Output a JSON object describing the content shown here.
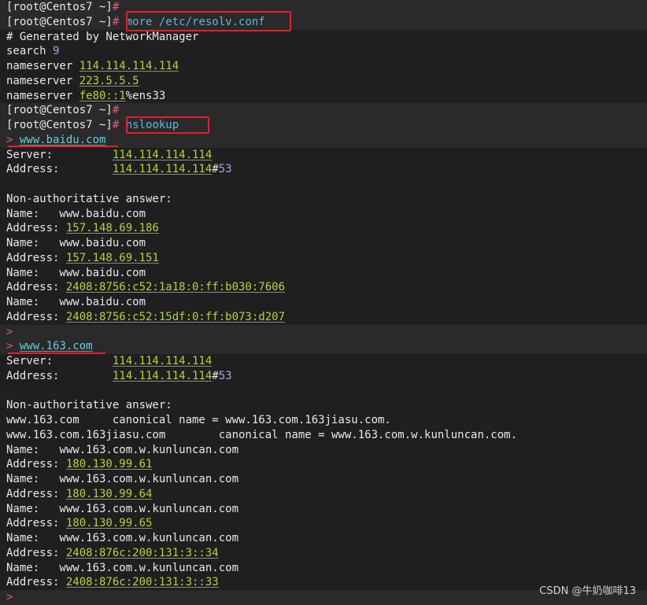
{
  "watermark": "CSDN @牛奶咖啡13",
  "colors": {
    "background": "#1f1f1f",
    "ip": "#b5d334",
    "port": "#b69ae6",
    "command": "#5fb3e6",
    "prompt_marker": "#e25a7a",
    "annotation": "#e0202a"
  },
  "lines": [
    {
      "hl": true,
      "segs": [
        {
          "t": "[root@Centos7 ~]",
          "c": "plain"
        },
        {
          "t": "#",
          "c": "hash"
        }
      ]
    },
    {
      "hl": true,
      "segs": [
        {
          "t": "[root@Centos7 ~]",
          "c": "plain"
        },
        {
          "t": "#",
          "c": "hash"
        },
        {
          "t": " more /etc/resolv.conf",
          "c": "cmd"
        }
      ]
    },
    {
      "hl": false,
      "segs": [
        {
          "t": "# Generated by NetworkManager",
          "c": "plain"
        }
      ]
    },
    {
      "hl": false,
      "segs": [
        {
          "t": "search ",
          "c": "plain"
        },
        {
          "t": "9",
          "c": "num"
        }
      ]
    },
    {
      "hl": false,
      "segs": [
        {
          "t": "nameserver ",
          "c": "plain"
        },
        {
          "t": "114.114.114.114",
          "c": "ip"
        }
      ]
    },
    {
      "hl": false,
      "segs": [
        {
          "t": "nameserver ",
          "c": "plain"
        },
        {
          "t": "223.5.5.5",
          "c": "ip"
        }
      ]
    },
    {
      "hl": false,
      "segs": [
        {
          "t": "nameserver ",
          "c": "plain"
        },
        {
          "t": "fe80::1",
          "c": "ip"
        },
        {
          "t": "%ens33",
          "c": "plain"
        }
      ]
    },
    {
      "hl": true,
      "segs": [
        {
          "t": "[root@Centos7 ~]",
          "c": "plain"
        },
        {
          "t": "#",
          "c": "hash"
        }
      ]
    },
    {
      "hl": true,
      "segs": [
        {
          "t": "[root@Centos7 ~]",
          "c": "plain"
        },
        {
          "t": "#",
          "c": "hash"
        },
        {
          "t": " nslookup",
          "c": "cmd"
        }
      ]
    },
    {
      "hl": true,
      "segs": [
        {
          "t": ">",
          "c": "prompt"
        },
        {
          "t": " ",
          "c": "plain"
        },
        {
          "t": "www.baidu.com",
          "c": "host"
        }
      ]
    },
    {
      "hl": false,
      "segs": [
        {
          "t": "Server:         ",
          "c": "plain"
        },
        {
          "t": "114.114.114.114",
          "c": "ip"
        }
      ]
    },
    {
      "hl": false,
      "segs": [
        {
          "t": "Address:        ",
          "c": "plain"
        },
        {
          "t": "114.114.114.114",
          "c": "ip"
        },
        {
          "t": "#",
          "c": "plain"
        },
        {
          "t": "53",
          "c": "num"
        }
      ]
    },
    {
      "hl": false,
      "segs": [
        {
          "t": "",
          "c": "plain"
        }
      ]
    },
    {
      "hl": false,
      "segs": [
        {
          "t": "Non-authoritative answer:",
          "c": "plain"
        }
      ]
    },
    {
      "hl": false,
      "segs": [
        {
          "t": "Name:   www.baidu.com",
          "c": "plain"
        }
      ]
    },
    {
      "hl": false,
      "segs": [
        {
          "t": "Address: ",
          "c": "plain"
        },
        {
          "t": "157.148.69.186",
          "c": "ip"
        }
      ]
    },
    {
      "hl": false,
      "segs": [
        {
          "t": "Name:   www.baidu.com",
          "c": "plain"
        }
      ]
    },
    {
      "hl": false,
      "segs": [
        {
          "t": "Address: ",
          "c": "plain"
        },
        {
          "t": "157.148.69.151",
          "c": "ip"
        }
      ]
    },
    {
      "hl": false,
      "segs": [
        {
          "t": "Name:   www.baidu.com",
          "c": "plain"
        }
      ]
    },
    {
      "hl": false,
      "segs": [
        {
          "t": "Address: ",
          "c": "plain"
        },
        {
          "t": "2408:8756:c52:1a18:0:ff:b030:7606",
          "c": "ip"
        }
      ]
    },
    {
      "hl": false,
      "segs": [
        {
          "t": "Name:   www.baidu.com",
          "c": "plain"
        }
      ]
    },
    {
      "hl": false,
      "segs": [
        {
          "t": "Address: ",
          "c": "plain"
        },
        {
          "t": "2408:8756:c52:15df:0:ff:b073:d207",
          "c": "ip"
        }
      ]
    },
    {
      "hl": true,
      "segs": [
        {
          "t": ">",
          "c": "prompt"
        }
      ]
    },
    {
      "hl": true,
      "segs": [
        {
          "t": ">",
          "c": "prompt"
        },
        {
          "t": " ",
          "c": "plain"
        },
        {
          "t": "www.163.com",
          "c": "host"
        }
      ]
    },
    {
      "hl": false,
      "segs": [
        {
          "t": "Server:         ",
          "c": "plain"
        },
        {
          "t": "114.114.114.114",
          "c": "ip"
        }
      ]
    },
    {
      "hl": false,
      "segs": [
        {
          "t": "Address:        ",
          "c": "plain"
        },
        {
          "t": "114.114.114.114",
          "c": "ip"
        },
        {
          "t": "#",
          "c": "plain"
        },
        {
          "t": "53",
          "c": "num"
        }
      ]
    },
    {
      "hl": false,
      "segs": [
        {
          "t": "",
          "c": "plain"
        }
      ]
    },
    {
      "hl": false,
      "segs": [
        {
          "t": "Non-authoritative answer:",
          "c": "plain"
        }
      ]
    },
    {
      "hl": false,
      "segs": [
        {
          "t": "www.163.com     canonical name = www.163.com.163jiasu.com.",
          "c": "plain"
        }
      ]
    },
    {
      "hl": false,
      "segs": [
        {
          "t": "www.163.com.163jiasu.com        canonical name = www.163.com.w.kunluncan.com.",
          "c": "plain"
        }
      ]
    },
    {
      "hl": false,
      "segs": [
        {
          "t": "Name:   www.163.com.w.kunluncan.com",
          "c": "plain"
        }
      ]
    },
    {
      "hl": false,
      "segs": [
        {
          "t": "Address: ",
          "c": "plain"
        },
        {
          "t": "180.130.99.61",
          "c": "ip"
        }
      ]
    },
    {
      "hl": false,
      "segs": [
        {
          "t": "Name:   www.163.com.w.kunluncan.com",
          "c": "plain"
        }
      ]
    },
    {
      "hl": false,
      "segs": [
        {
          "t": "Address: ",
          "c": "plain"
        },
        {
          "t": "180.130.99.64",
          "c": "ip"
        }
      ]
    },
    {
      "hl": false,
      "segs": [
        {
          "t": "Name:   www.163.com.w.kunluncan.com",
          "c": "plain"
        }
      ]
    },
    {
      "hl": false,
      "segs": [
        {
          "t": "Address: ",
          "c": "plain"
        },
        {
          "t": "180.130.99.65",
          "c": "ip"
        }
      ]
    },
    {
      "hl": false,
      "segs": [
        {
          "t": "Name:   www.163.com.w.kunluncan.com",
          "c": "plain"
        }
      ]
    },
    {
      "hl": false,
      "segs": [
        {
          "t": "Address: ",
          "c": "plain"
        },
        {
          "t": "2408:876c:200:131:3::34",
          "c": "ip"
        }
      ]
    },
    {
      "hl": false,
      "segs": [
        {
          "t": "Name:   www.163.com.w.kunluncan.com",
          "c": "plain"
        }
      ]
    },
    {
      "hl": false,
      "segs": [
        {
          "t": "Address: ",
          "c": "plain"
        },
        {
          "t": "2408:876c:200:131:3::33",
          "c": "ip"
        }
      ]
    },
    {
      "hl": true,
      "segs": [
        {
          "t": ">",
          "c": "prompt"
        }
      ]
    }
  ]
}
